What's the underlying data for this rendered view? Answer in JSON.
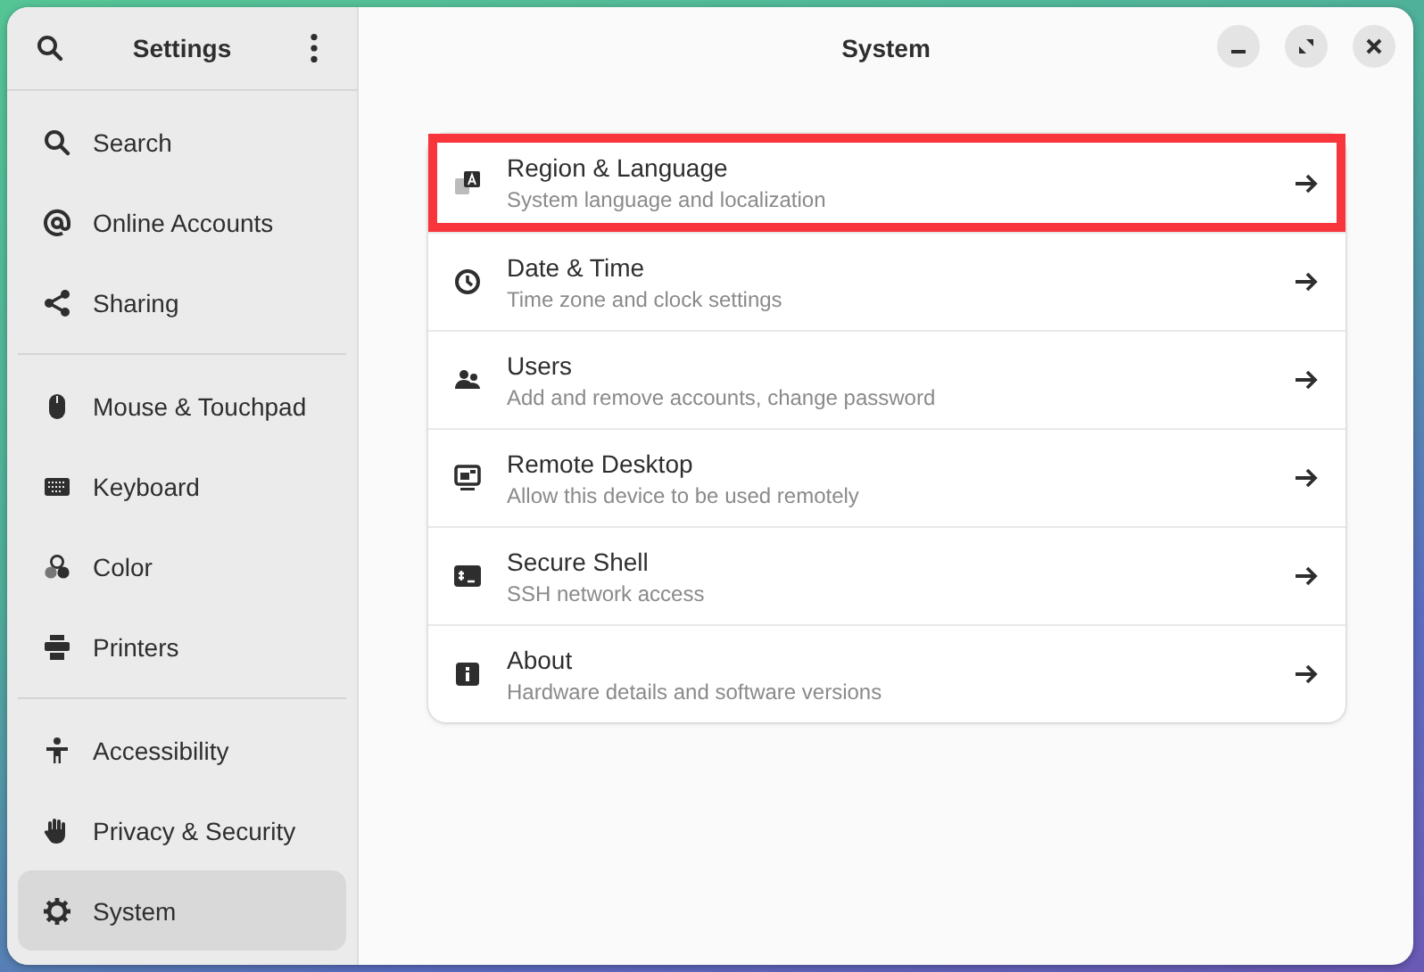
{
  "sidebar": {
    "title": "Settings",
    "groups": [
      [
        {
          "label": "Search",
          "kind": "search",
          "selected": false
        },
        {
          "label": "Online Accounts",
          "kind": "at",
          "selected": false
        },
        {
          "label": "Sharing",
          "kind": "share",
          "selected": false
        }
      ],
      [
        {
          "label": "Mouse & Touchpad",
          "kind": "mouse",
          "selected": false
        },
        {
          "label": "Keyboard",
          "kind": "keyboard",
          "selected": false
        },
        {
          "label": "Color",
          "kind": "color",
          "selected": false
        },
        {
          "label": "Printers",
          "kind": "printer",
          "selected": false
        }
      ],
      [
        {
          "label": "Accessibility",
          "kind": "person",
          "selected": false
        },
        {
          "label": "Privacy & Security",
          "kind": "hand",
          "selected": false
        },
        {
          "label": "System",
          "kind": "gear",
          "selected": true
        }
      ]
    ]
  },
  "main": {
    "title": "System",
    "rows": [
      {
        "title": "Region & Language",
        "subtitle": "System language and localization",
        "kind": "language",
        "highlighted": true
      },
      {
        "title": "Date & Time",
        "subtitle": "Time zone and clock settings",
        "kind": "clock",
        "highlighted": false
      },
      {
        "title": "Users",
        "subtitle": "Add and remove accounts, change password",
        "kind": "users",
        "highlighted": false
      },
      {
        "title": "Remote Desktop",
        "subtitle": "Allow this device to be used remotely",
        "kind": "monitor",
        "highlighted": false
      },
      {
        "title": "Secure Shell",
        "subtitle": "SSH network access",
        "kind": "terminal",
        "highlighted": false
      },
      {
        "title": "About",
        "subtitle": "Hardware details and software versions",
        "kind": "info",
        "highlighted": false
      }
    ]
  }
}
